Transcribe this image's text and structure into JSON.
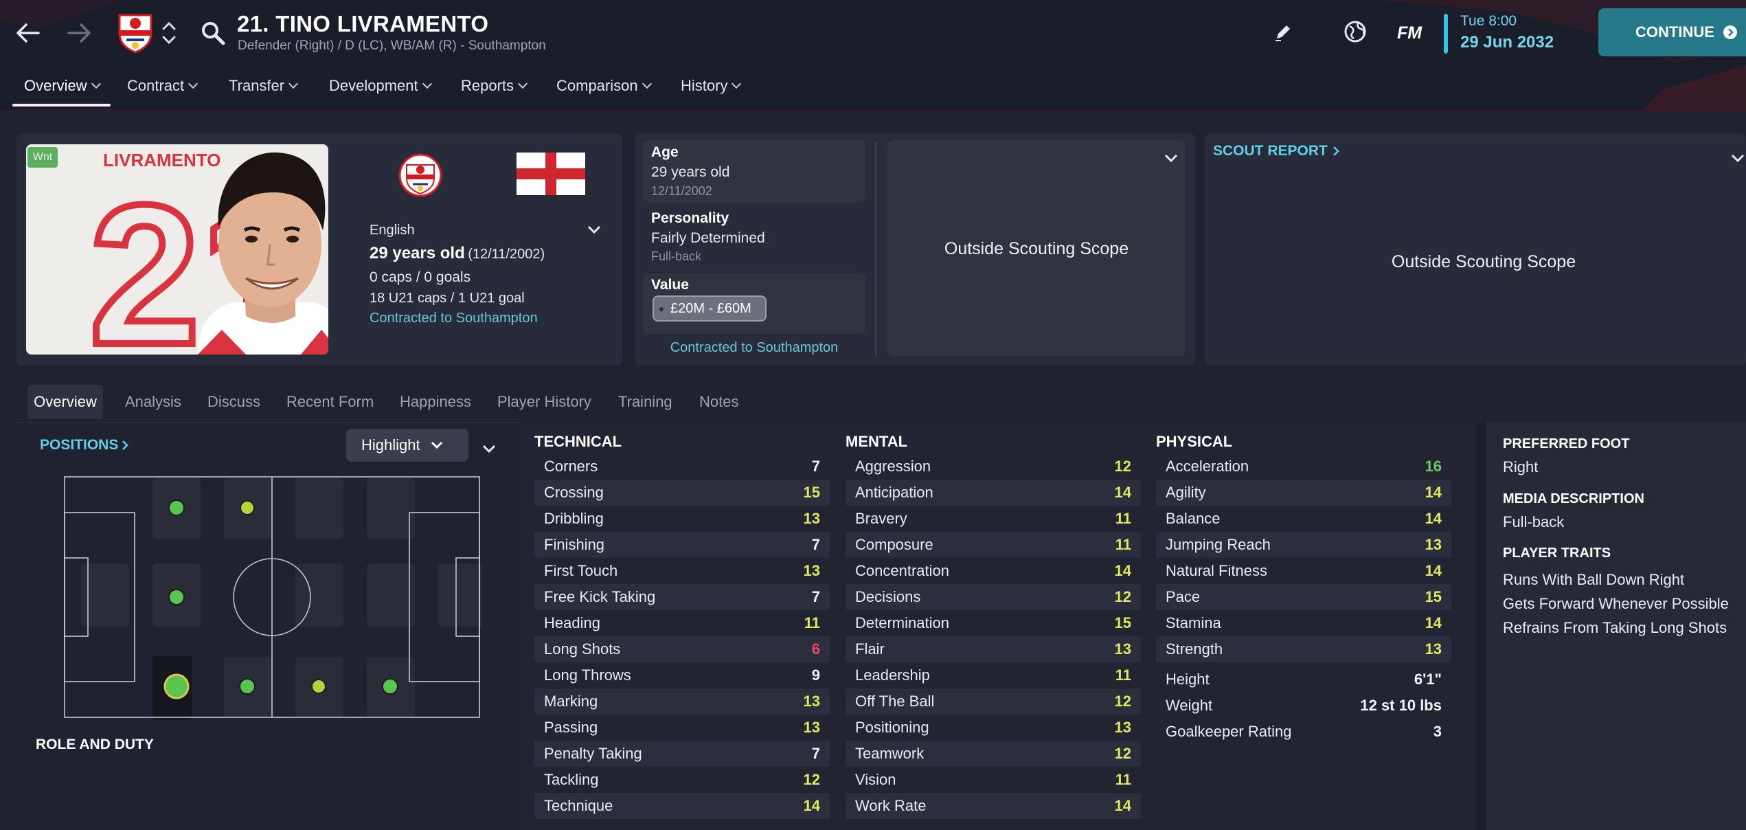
{
  "header": {
    "title": "21. TINO LIVRAMENTO",
    "subtitle": "Defender (Right) / D (LC), WB/AM (R) - Southampton",
    "fm_label": "FM",
    "time": "Tue 8:00",
    "date": "29 Jun 2032",
    "continue_label": "CONTINUE"
  },
  "nav_tabs": [
    {
      "label": "Overview"
    },
    {
      "label": "Contract"
    },
    {
      "label": "Transfer"
    },
    {
      "label": "Development"
    },
    {
      "label": "Reports"
    },
    {
      "label": "Comparison"
    },
    {
      "label": "History"
    }
  ],
  "profile": {
    "badge": "Wnt",
    "shirt_name": "LIVRAMENTO",
    "shirt_number": "21",
    "nationality": "English",
    "age_text": "29 years old",
    "dob_paren": "(12/11/2002)",
    "caps": "0 caps / 0 goals",
    "u21_caps": "18 U21 caps / 1 U21 goal",
    "contract": "Contracted to Southampton"
  },
  "info": {
    "age_label": "Age",
    "age_value": "29 years old",
    "dob": "12/11/2002",
    "personality_label": "Personality",
    "personality_value": "Fairly Determined",
    "personality_sub": "Full-back",
    "value_label": "Value",
    "value_range": "£20M - £60M",
    "contract": "Contracted to Southampton",
    "scope_text": "Outside Scouting Scope"
  },
  "scout": {
    "title": "SCOUT REPORT",
    "scope_text": "Outside Scouting Scope"
  },
  "subtabs": [
    {
      "label": "Overview"
    },
    {
      "label": "Analysis"
    },
    {
      "label": "Discuss"
    },
    {
      "label": "Recent Form"
    },
    {
      "label": "Happiness"
    },
    {
      "label": "Player History"
    },
    {
      "label": "Training"
    },
    {
      "label": "Notes"
    }
  ],
  "positions": {
    "title": "POSITIONS",
    "highlight_label": "Highlight",
    "role_duty": "ROLE AND DUTY"
  },
  "technical": {
    "title": "TECHNICAL",
    "rows": [
      {
        "name": "Corners",
        "value": "7",
        "color": "#f2f2f2"
      },
      {
        "name": "Crossing",
        "value": "15",
        "color": "#dfe860"
      },
      {
        "name": "Dribbling",
        "value": "13",
        "color": "#dfe860"
      },
      {
        "name": "Finishing",
        "value": "7",
        "color": "#f2f2f2"
      },
      {
        "name": "First Touch",
        "value": "13",
        "color": "#dfe860"
      },
      {
        "name": "Free Kick Taking",
        "value": "7",
        "color": "#f2f2f2"
      },
      {
        "name": "Heading",
        "value": "11",
        "color": "#dfe860"
      },
      {
        "name": "Long Shots",
        "value": "6",
        "color": "#e64a61"
      },
      {
        "name": "Long Throws",
        "value": "9",
        "color": "#f2f2f2"
      },
      {
        "name": "Marking",
        "value": "13",
        "color": "#dfe860"
      },
      {
        "name": "Passing",
        "value": "13",
        "color": "#dfe860"
      },
      {
        "name": "Penalty Taking",
        "value": "7",
        "color": "#f2f2f2"
      },
      {
        "name": "Tackling",
        "value": "12",
        "color": "#dfe860"
      },
      {
        "name": "Technique",
        "value": "14",
        "color": "#dfe860"
      }
    ]
  },
  "mental": {
    "title": "MENTAL",
    "rows": [
      {
        "name": "Aggression",
        "value": "12",
        "color": "#dfe860"
      },
      {
        "name": "Anticipation",
        "value": "14",
        "color": "#dfe860"
      },
      {
        "name": "Bravery",
        "value": "11",
        "color": "#dfe860"
      },
      {
        "name": "Composure",
        "value": "11",
        "color": "#dfe860"
      },
      {
        "name": "Concentration",
        "value": "14",
        "color": "#dfe860"
      },
      {
        "name": "Decisions",
        "value": "12",
        "color": "#dfe860"
      },
      {
        "name": "Determination",
        "value": "15",
        "color": "#dfe860"
      },
      {
        "name": "Flair",
        "value": "13",
        "color": "#dfe860"
      },
      {
        "name": "Leadership",
        "value": "11",
        "color": "#dfe860"
      },
      {
        "name": "Off The Ball",
        "value": "12",
        "color": "#dfe860"
      },
      {
        "name": "Positioning",
        "value": "13",
        "color": "#dfe860"
      },
      {
        "name": "Teamwork",
        "value": "12",
        "color": "#dfe860"
      },
      {
        "name": "Vision",
        "value": "11",
        "color": "#dfe860"
      },
      {
        "name": "Work Rate",
        "value": "14",
        "color": "#dfe860"
      }
    ]
  },
  "physical": {
    "title": "PHYSICAL",
    "rows": [
      {
        "name": "Acceleration",
        "value": "16",
        "color": "#66cd5a"
      },
      {
        "name": "Agility",
        "value": "14",
        "color": "#dfe860"
      },
      {
        "name": "Balance",
        "value": "14",
        "color": "#dfe860"
      },
      {
        "name": "Jumping Reach",
        "value": "13",
        "color": "#dfe860"
      },
      {
        "name": "Natural Fitness",
        "value": "14",
        "color": "#dfe860"
      },
      {
        "name": "Pace",
        "value": "15",
        "color": "#dfe860"
      },
      {
        "name": "Stamina",
        "value": "14",
        "color": "#dfe860"
      },
      {
        "name": "Strength",
        "value": "13",
        "color": "#dfe860"
      }
    ],
    "extra": [
      {
        "name": "Height",
        "value": "6'1\""
      },
      {
        "name": "Weight",
        "value": "12 st 10 lbs"
      },
      {
        "name": "Goalkeeper Rating",
        "value": "3"
      }
    ]
  },
  "details": {
    "preferred_foot_title": "PREFERRED FOOT",
    "preferred_foot": "Right",
    "media_title": "MEDIA DESCRIPTION",
    "media": "Full-back",
    "traits_title": "PLAYER TRAITS",
    "traits": [
      "Runs With Ball Down Right",
      "Gets Forward Whenever Possible",
      "Refrains From Taking Long Shots"
    ]
  },
  "colors": {
    "accent": "#36c2e6",
    "continue": "#267988",
    "attr_yellow": "#dfe860",
    "attr_green": "#66cd5a",
    "attr_red": "#e64a61"
  }
}
